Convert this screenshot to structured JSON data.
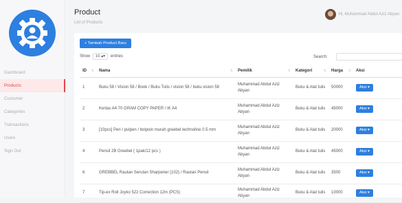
{
  "sidebar": {
    "items": [
      {
        "label": "Dashboard",
        "active": false
      },
      {
        "label": "Products",
        "active": true
      },
      {
        "label": "Customer",
        "active": false
      },
      {
        "label": "Categories",
        "active": false
      },
      {
        "label": "Transactions",
        "active": false
      },
      {
        "label": "Users",
        "active": false
      },
      {
        "label": "Sign Out",
        "active": false
      }
    ]
  },
  "header": {
    "title": "Product",
    "subtitle": "List of Products",
    "user_greeting": "Hi, Muhammad Abdul Aziz Abyan"
  },
  "toolbar": {
    "add_label": "+ Tambah Product Baru",
    "show_label": "Show",
    "entries_value": "10",
    "entries_label": "entries",
    "search_label": "Search:"
  },
  "table": {
    "headers": {
      "id": "ID",
      "nama": "Nama",
      "pemilik": "Pemilik",
      "kategori": "Kategori",
      "harga": "Harga",
      "aksi": "Aksi"
    },
    "rows": [
      {
        "id": "1",
        "nama": "Buku 58 / Vision 58 / Book / Buku Tulis / vision 58 / buku vision 58",
        "pemilik": "Muhammad Abdul Aziz Abyan",
        "kategori": "Buku & Alat tulis",
        "harga": "50000",
        "aksi": "Aksi ▾"
      },
      {
        "id": "2",
        "nama": "Kertas A4 70 GRAM COPY PAPER / lK A4",
        "pemilik": "Muhammad Abdul Aziz Abyan",
        "kategori": "Buku & Alat tulis",
        "harga": "45000",
        "aksi": "Aksi ▾"
      },
      {
        "id": "3",
        "nama": "[10pcs] Pen / pulpen / bolpoin murah greebel technoline 0.5 mm",
        "pemilik": "Muhammad Abdul Aziz Abyan",
        "kategori": "Buku & Alat tulis",
        "harga": "20000",
        "aksi": "Aksi ▾"
      },
      {
        "id": "4",
        "nama": "Pensil 2B Greebel ( 1pak/12 pcs )",
        "pemilik": "Muhammad Abdul Aziz Abyan",
        "kategori": "Buku & Alat tulis",
        "harga": "45000",
        "aksi": "Aksi ▾"
      },
      {
        "id": "6",
        "nama": "GREBBEL Rautan Serutan Sharpener (102) / Rautan Pensil",
        "pemilik": "Muhammad Abdul Aziz Abyan",
        "kategori": "Buku & Alat tulis",
        "harga": "3500",
        "aksi": "Aksi ▾"
      },
      {
        "id": "7",
        "nama": "Tip-ex Roll Joyko 522 Correction 12m (PCS)",
        "pemilik": "Muhammad Abdul Aziz Abyan",
        "kategori": "Buku & Alat tulis",
        "harga": "10000",
        "aksi": "Aksi ▾"
      }
    ]
  },
  "colors": {
    "accent": "#2d7fe0",
    "active_nav": "#e0474c"
  },
  "icons": {
    "logo": "settings-user-icon",
    "sort": "sort-arrows-icon"
  }
}
